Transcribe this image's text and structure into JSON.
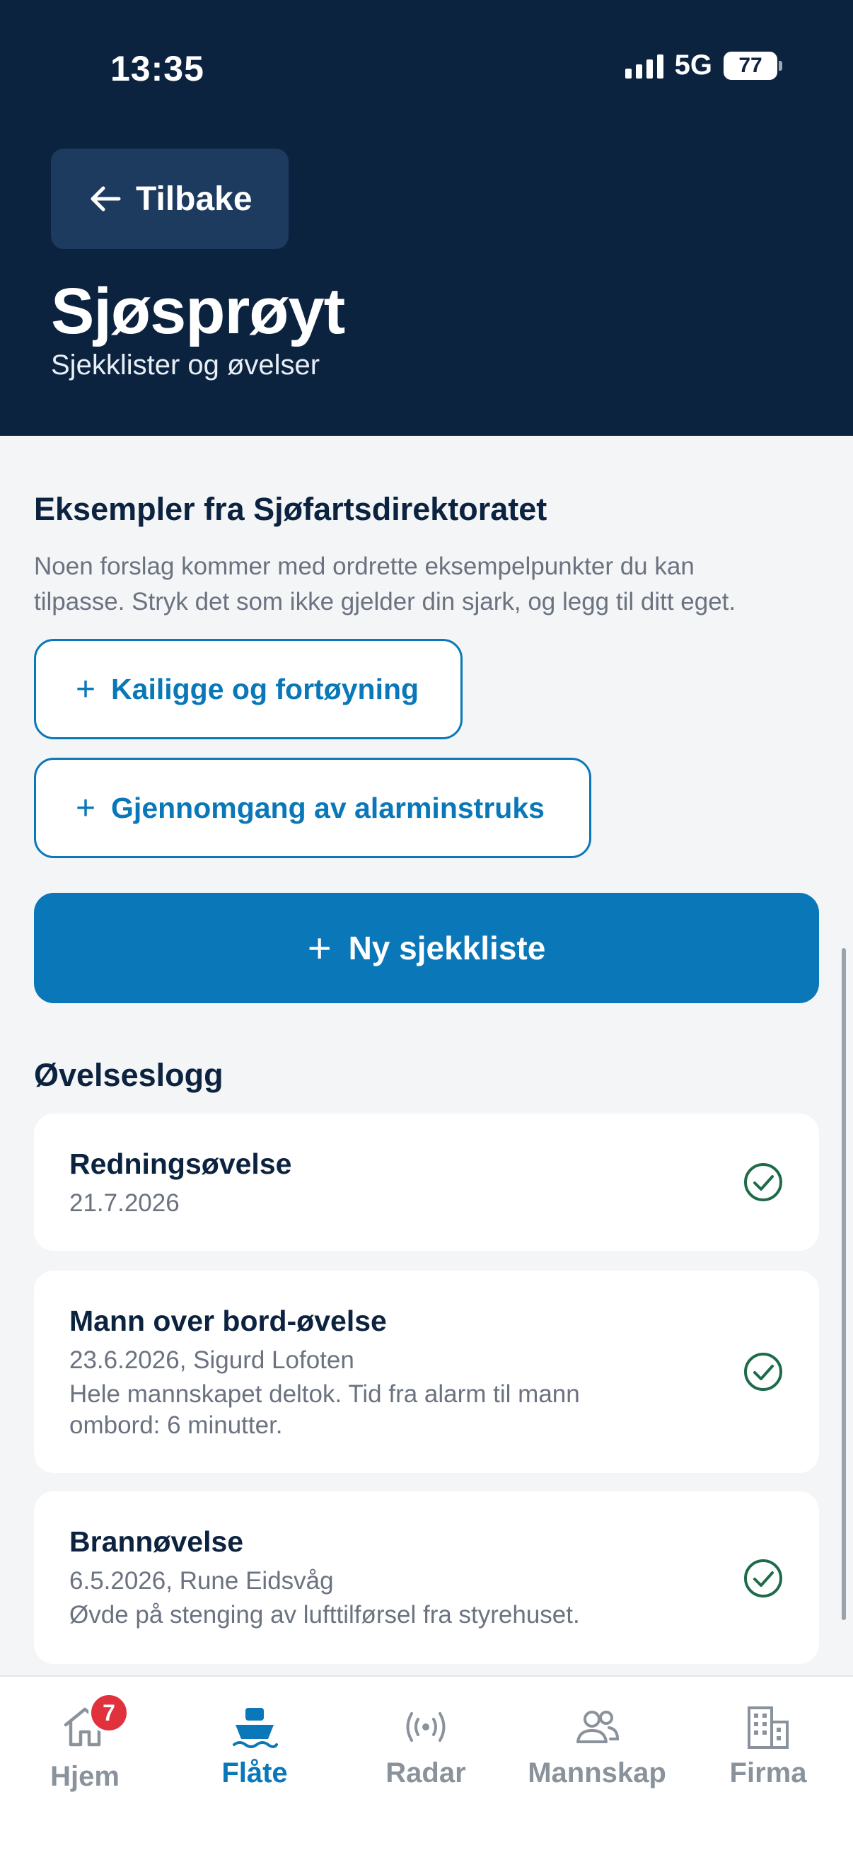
{
  "status": {
    "time": "13:35",
    "network": "5G",
    "battery": "77"
  },
  "header": {
    "back_label": "Tilbake",
    "title": "Sjøsprøyt",
    "subtitle": "Sjekklister og øvelser"
  },
  "examples": {
    "title": "Eksempler fra Sjøfartsdirektoratet",
    "intro_line1": "Noen forslag kommer med ordrette eksempelpunkter du kan",
    "intro_line2": "tilpasse. Stryk det som ikke gjelder din sjark, og legg til ditt eget.",
    "buttons": [
      {
        "label": "Kailigge og fortøyning"
      },
      {
        "label": "Gjennomgang av alarminstruks"
      }
    ]
  },
  "new_checklist_label": "Ny sjekkliste",
  "log": {
    "title": "Øvelseslogg",
    "items": [
      {
        "title": "Redningsøvelse",
        "meta": "21.7.2026",
        "note_line1": "",
        "note_line2": ""
      },
      {
        "title": "Mann over bord-øvelse",
        "meta": "23.6.2026, Sigurd Lofoten",
        "note_line1": "Hele mannskapet deltok. Tid fra alarm til mann",
        "note_line2": "ombord: 6 minutter."
      },
      {
        "title": "Brannøvelse",
        "meta": "6.5.2026, Rune Eidsvåg",
        "note_line1": "Øvde på stenging av lufttilførsel fra styrehuset.",
        "note_line2": ""
      }
    ]
  },
  "nav": {
    "items": [
      {
        "label": "Hjem",
        "badge": "7",
        "icon": "home-icon"
      },
      {
        "label": "Flåte",
        "icon": "boat-icon"
      },
      {
        "label": "Radar",
        "icon": "radar-icon"
      },
      {
        "label": "Mannskap",
        "icon": "crew-icon"
      },
      {
        "label": "Firma",
        "icon": "building-icon"
      }
    ],
    "active": "Flåte"
  },
  "colors": {
    "header_bg": "#0c2340",
    "accent": "#0a78b8",
    "success": "#1e6b4a",
    "badge": "#e0313d"
  }
}
